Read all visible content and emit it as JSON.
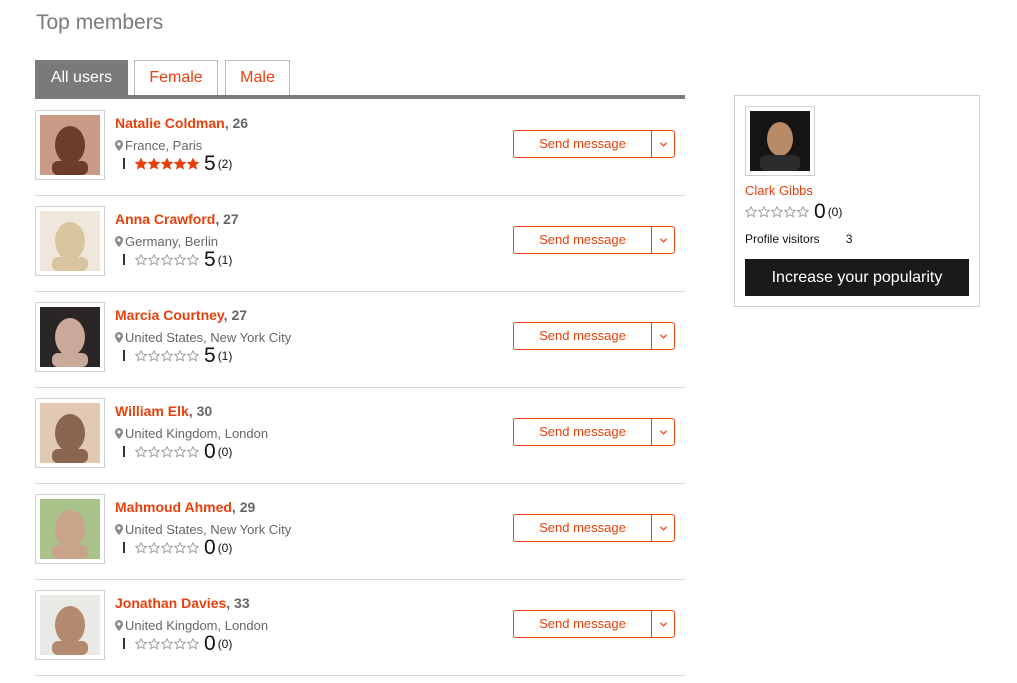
{
  "page": {
    "title": "Top members"
  },
  "tabs": [
    {
      "label": "All users",
      "active": true
    },
    {
      "label": "Female",
      "active": false
    },
    {
      "label": "Male",
      "active": false
    }
  ],
  "colors": {
    "accent": "#e8400c",
    "tab_active": "#7a7a7a",
    "star_filled": "#e8400c",
    "star_empty": "#9a9a9a",
    "dark_button": "#1a1a1a"
  },
  "icons": {
    "location": "map-pin-icon",
    "dropdown": "chevron-down-icon",
    "rating": "star-icon"
  },
  "members": [
    {
      "name": "Natalie Coldman",
      "age_suffix": ", 26",
      "location": "France, Paris",
      "stars_filled": 5,
      "rating": "5",
      "rating_count": "(2)",
      "send_label": "Send message",
      "avatar_colors": [
        "#c99a86",
        "#6b3d2a"
      ]
    },
    {
      "name": "Anna Crawford",
      "age_suffix": ", 27",
      "location": "Germany, Berlin",
      "stars_filled": 0,
      "rating": "5",
      "rating_count": "(1)",
      "send_label": "Send message",
      "avatar_colors": [
        "#efe6dc",
        "#d8c49e"
      ]
    },
    {
      "name": "Marcia Courtney",
      "age_suffix": ", 27",
      "location": "United States, New York City",
      "stars_filled": 0,
      "rating": "5",
      "rating_count": "(1)",
      "send_label": "Send message",
      "avatar_colors": [
        "#2a2626",
        "#c9a999"
      ]
    },
    {
      "name": "William Elk",
      "age_suffix": ", 30",
      "location": "United Kingdom, London",
      "stars_filled": 0,
      "rating": "0",
      "rating_count": "(0)",
      "send_label": "Send message",
      "avatar_colors": [
        "#e2c9b4",
        "#8a6650"
      ]
    },
    {
      "name": "Mahmoud Ahmed",
      "age_suffix": ", 29",
      "location": "United States, New York City",
      "stars_filled": 0,
      "rating": "0",
      "rating_count": "(0)",
      "send_label": "Send message",
      "avatar_colors": [
        "#a9c28a",
        "#c9a48a"
      ]
    },
    {
      "name": "Jonathan Davies",
      "age_suffix": ", 33",
      "location": "United Kingdom, London",
      "stars_filled": 0,
      "rating": "0",
      "rating_count": "(0)",
      "send_label": "Send message",
      "avatar_colors": [
        "#e9e9e6",
        "#b48a6e"
      ]
    }
  ],
  "profile": {
    "name": "Clark Gibbs",
    "stars_filled": 0,
    "rating": "0",
    "rating_count": "(0)",
    "visitors_label": "Profile visitors",
    "visitors_count": "3",
    "button_label": "Increase your popularity",
    "avatar_colors": [
      "#151515",
      "#b98a66"
    ]
  }
}
